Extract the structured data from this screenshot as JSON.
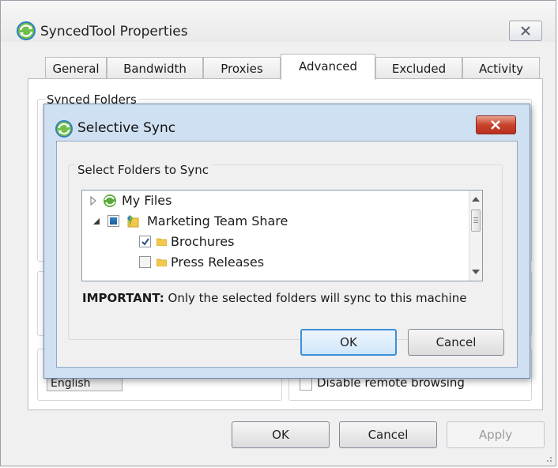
{
  "window": {
    "title": "SyncedTool Properties"
  },
  "tabs": [
    {
      "label": "General"
    },
    {
      "label": "Bandwidth"
    },
    {
      "label": "Proxies"
    },
    {
      "label": "Advanced"
    },
    {
      "label": "Excluded"
    },
    {
      "label": "Activity"
    }
  ],
  "active_tab": "Advanced",
  "advanced": {
    "synced_folders_label": "Synced Folders",
    "language_value": "English",
    "remote_browsing_label": "Disable remote browsing"
  },
  "footer": {
    "ok": "OK",
    "cancel": "Cancel",
    "apply": "Apply"
  },
  "dialog": {
    "title": "Selective Sync",
    "group_label": "Select Folders to Sync",
    "tree": [
      {
        "label": "My Files",
        "expanded": false,
        "checked": null
      },
      {
        "label": "Marketing Team Share",
        "expanded": true,
        "checked": "partial"
      },
      {
        "label": "Brochures",
        "checked": true
      },
      {
        "label": "Press Releases",
        "checked": false
      }
    ],
    "important_prefix": "IMPORTANT:",
    "important_text": " Only the selected folders will sync to this machine",
    "ok": "OK",
    "cancel": "Cancel"
  },
  "colors": {
    "dialog_frame": "#cfe0f2",
    "close_red": "#c9432c",
    "folder_yellow": "#f2c94c",
    "primary_border": "#3c8fd9"
  }
}
